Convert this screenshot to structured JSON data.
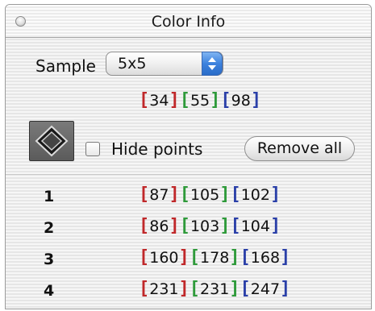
{
  "window": {
    "title": "Color Info"
  },
  "sample": {
    "label": "Sample",
    "value": "5x5"
  },
  "current_color": {
    "r": "34",
    "g": "55",
    "b": "98"
  },
  "controls": {
    "hide_points_label": "Hide points",
    "remove_all_label": "Remove all"
  },
  "points": [
    {
      "index": "1",
      "r": "87",
      "g": "105",
      "b": "102"
    },
    {
      "index": "2",
      "r": "86",
      "g": "103",
      "b": "104"
    },
    {
      "index": "3",
      "r": "160",
      "g": "178",
      "b": "168"
    },
    {
      "index": "4",
      "r": "231",
      "g": "231",
      "b": "247"
    }
  ],
  "colors": {
    "red_bracket": "#c0282a",
    "green_bracket": "#2e9a3a",
    "blue_bracket": "#2a3fa8"
  },
  "icons": {
    "close": "close-icon",
    "tool": "diamond-target-icon",
    "popup": "up-down-arrows-icon"
  }
}
